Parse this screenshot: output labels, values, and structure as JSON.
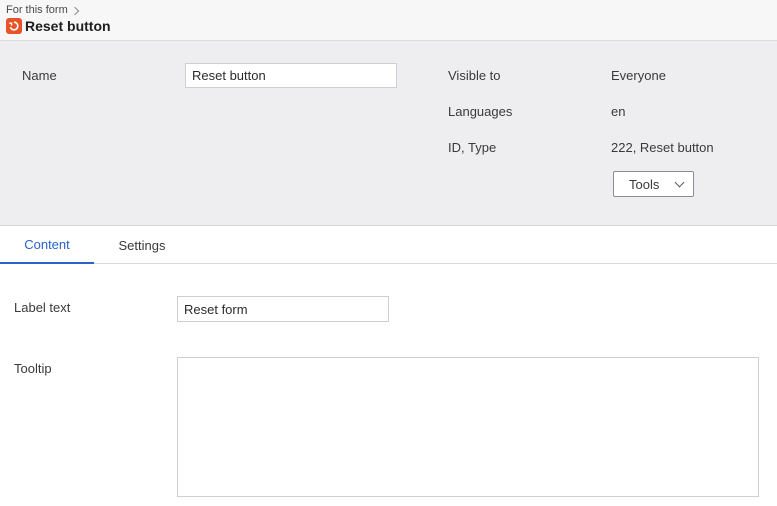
{
  "header": {
    "breadcrumb": "For this form",
    "title": "Reset button",
    "icon": "reset-icon",
    "icon_color": "#e8542a"
  },
  "properties": {
    "name_label": "Name",
    "name_value": "Reset button",
    "visible_to_label": "Visible to",
    "visible_to_value": "Everyone",
    "languages_label": "Languages",
    "languages_value": "en",
    "id_type_label": "ID, Type",
    "id_type_value": "222, Reset button",
    "tools_label": "Tools"
  },
  "tabs": [
    {
      "label": "Content",
      "active": true
    },
    {
      "label": "Settings",
      "active": false
    }
  ],
  "content": {
    "label_text_label": "Label text",
    "label_text_value": "Reset form",
    "tooltip_label": "Tooltip",
    "tooltip_value": ""
  },
  "colors": {
    "accent": "#2b63c6",
    "panel_bg": "#eeeef0"
  }
}
